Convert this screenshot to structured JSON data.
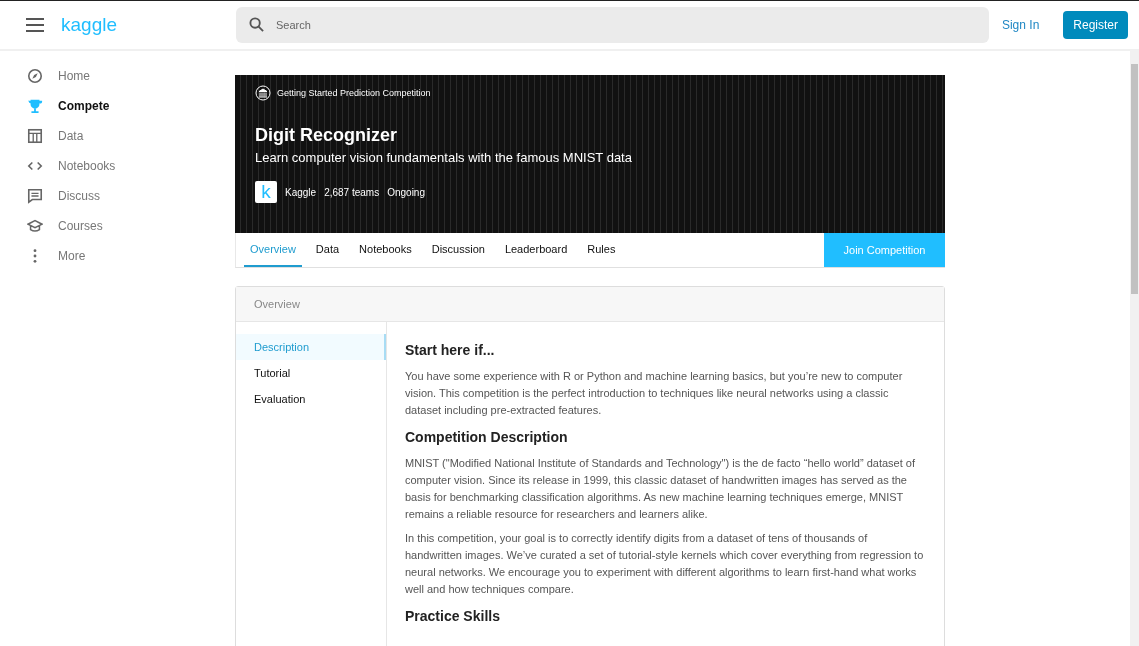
{
  "header": {
    "logo": "kaggle",
    "search": {
      "placeholder": "Search"
    },
    "sign_in": "Sign In",
    "register": "Register"
  },
  "sidebar": {
    "items": [
      {
        "label": "Home",
        "selected": false
      },
      {
        "label": "Compete",
        "selected": true
      },
      {
        "label": "Data",
        "selected": false
      },
      {
        "label": "Notebooks",
        "selected": false
      },
      {
        "label": "Discuss",
        "selected": false
      },
      {
        "label": "Courses",
        "selected": false
      },
      {
        "label": "More",
        "selected": false
      }
    ]
  },
  "banner": {
    "category": "Getting Started Prediction Competition",
    "title": "Digit Recognizer",
    "subtitle": "Learn computer vision fundamentals with the famous MNIST data",
    "host_logo": "k",
    "host": "Kaggle",
    "teams": "2,687 teams",
    "status": "Ongoing"
  },
  "tabs": [
    {
      "label": "Overview",
      "selected": true
    },
    {
      "label": "Data",
      "selected": false
    },
    {
      "label": "Notebooks",
      "selected": false
    },
    {
      "label": "Discussion",
      "selected": false
    },
    {
      "label": "Leaderboard",
      "selected": false
    },
    {
      "label": "Rules",
      "selected": false
    }
  ],
  "join_button": "Join Competition",
  "overview": {
    "title": "Overview",
    "sections": [
      {
        "label": "Description",
        "selected": true
      },
      {
        "label": "Tutorial",
        "selected": false
      },
      {
        "label": "Evaluation",
        "selected": false
      }
    ],
    "content": [
      {
        "kind": "heading",
        "text": "Start here if..."
      },
      {
        "kind": "paragraph",
        "text": "You have some experience with R or Python and machine learning basics, but you’re new to computer vision. This competition is the perfect introduction to techniques like neural networks using a classic dataset including pre-extracted features."
      },
      {
        "kind": "heading",
        "text": "Competition Description"
      },
      {
        "kind": "paragraph",
        "text": "MNIST (\"Modified National Institute of Standards and Technology\") is the de facto “hello world” dataset of computer vision. Since its release in 1999, this classic dataset of handwritten images has served as the basis for benchmarking classification algorithms. As new machine learning techniques emerge, MNIST remains a reliable resource for researchers and learners alike."
      },
      {
        "kind": "paragraph",
        "text": "In this competition, your goal is to correctly identify digits from a dataset of tens of thousands of handwritten images. We’ve curated a set of tutorial-style kernels which cover everything from regression to neural networks. We encourage you to experiment with different algorithms to learn first-hand what works well and how techniques compare."
      },
      {
        "kind": "heading",
        "text": "Practice Skills"
      }
    ]
  }
}
